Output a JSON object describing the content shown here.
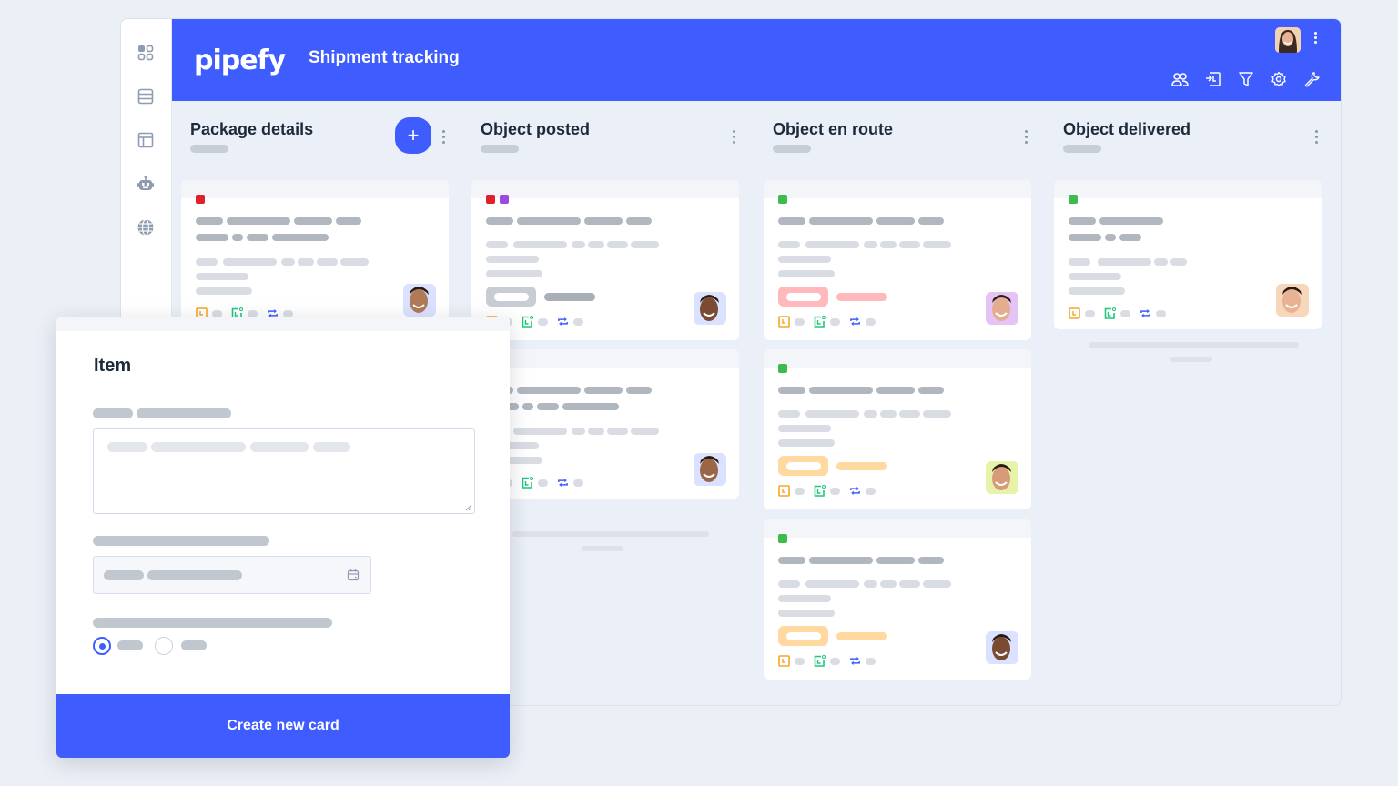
{
  "header": {
    "logo": "pipefy",
    "pipe_title": "Shipment tracking",
    "tools": [
      "members-icon",
      "import-icon",
      "filter-icon",
      "settings-icon",
      "wrench-icon"
    ]
  },
  "sidebar": {
    "items": [
      "apps-icon",
      "database-icon",
      "layout-icon",
      "bot-icon",
      "globe-icon"
    ]
  },
  "colors": {
    "brand": "#3f5cff",
    "label_red": "#e0202a",
    "label_purple": "#9b4be0",
    "label_green": "#3dbb4c",
    "tag_red": "#ffb9bd",
    "tag_orange": "#ffd9a0",
    "tag_gray": "#c8cdd4"
  },
  "phases": [
    {
      "title": "Package details",
      "has_add_button": true,
      "add_label": "+"
    },
    {
      "title": "Object posted"
    },
    {
      "title": "Object en route"
    },
    {
      "title": "Object delivered"
    }
  ],
  "modal": {
    "title": "Item",
    "create_button": "Create new card"
  }
}
